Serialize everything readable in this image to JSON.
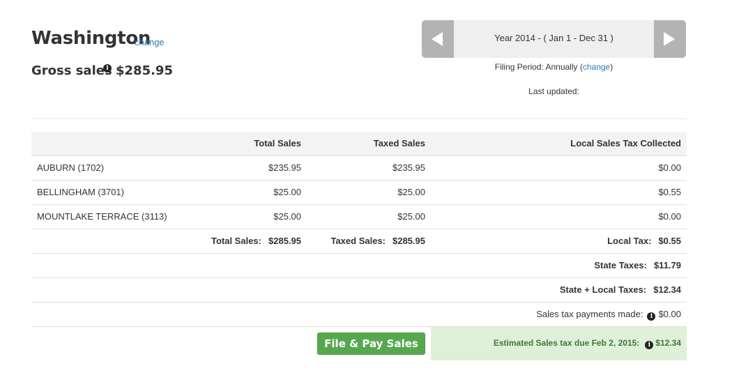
{
  "header": {
    "state": "Washington",
    "change_label": "change",
    "gross_label": "Gross sales",
    "gross_value": "$285.95"
  },
  "period": {
    "label": "Year 2014 - ( Jan 1 - Dec 31 )",
    "filing_prefix": "Filing Period: Annually (",
    "filing_change": "change",
    "filing_suffix": ")",
    "last_updated": "Last updated:"
  },
  "table": {
    "headers": [
      "",
      "Total Sales",
      "Taxed Sales",
      "Local Sales Tax Collected"
    ],
    "rows": [
      {
        "name": "AUBURN (1702)",
        "total": "$235.95",
        "taxed": "$235.95",
        "local": "$0.00"
      },
      {
        "name": "BELLINGHAM (3701)",
        "total": "$25.00",
        "taxed": "$25.00",
        "local": "$0.55"
      },
      {
        "name": "MOUNTLAKE TERRACE (3113)",
        "total": "$25.00",
        "taxed": "$25.00",
        "local": "$0.00"
      }
    ],
    "totals": {
      "total_label": "Total Sales:",
      "total_value": "$285.95",
      "taxed_label": "Taxed Sales:",
      "taxed_value": "$285.95",
      "local_label": "Local Tax:",
      "local_value": "$0.55"
    },
    "state_taxes_label": "State Taxes:",
    "state_taxes_value": "$11.79",
    "state_local_label": "State + Local Taxes:",
    "state_local_value": "$12.34",
    "payments_label": "Sales tax payments made:",
    "payments_value": "$0.00"
  },
  "footer": {
    "file_button": "File & Pay Sales Tax",
    "due_label": "Estimated Sales tax due Feb 2, 2015:",
    "due_value": "$12.34"
  },
  "icons": {
    "info": "info-icon",
    "prev": "chevron-left-icon",
    "next": "chevron-right-icon"
  },
  "colors": {
    "link": "#2a7ab8",
    "button_green": "#56a84f",
    "due_background": "#dff0d8",
    "due_text": "#3c763d"
  }
}
